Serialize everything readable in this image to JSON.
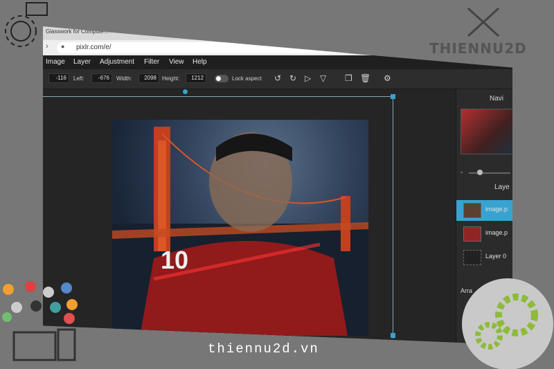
{
  "browser": {
    "tab_title": "Glasswork for Compute...",
    "url": "pixlr.com/e/"
  },
  "menu": [
    "Image",
    "Layer",
    "Adjustment",
    "Filter",
    "View",
    "Help"
  ],
  "toolbar": {
    "top_value": "-116",
    "left_label": "Left:",
    "left_value": "-676",
    "width_label": "Width:",
    "width_value": "2098",
    "height_label": "Height:",
    "height_value": "1212",
    "lock_label": "Lock aspect"
  },
  "panel": {
    "navigator_title": "Navi",
    "layers_title": "Laye",
    "layers": [
      {
        "name": "image.p",
        "active": true
      },
      {
        "name": "image.p",
        "active": false
      },
      {
        "name": "Layer 0",
        "active": false
      }
    ],
    "arrange_label": "Arra"
  },
  "watermark": {
    "site": "thiennu2d.vn",
    "logo": "THIENNU2D"
  },
  "colors": {
    "accent": "#38a3d1",
    "background": "#777777",
    "toolbar": "#2d2d2d"
  }
}
